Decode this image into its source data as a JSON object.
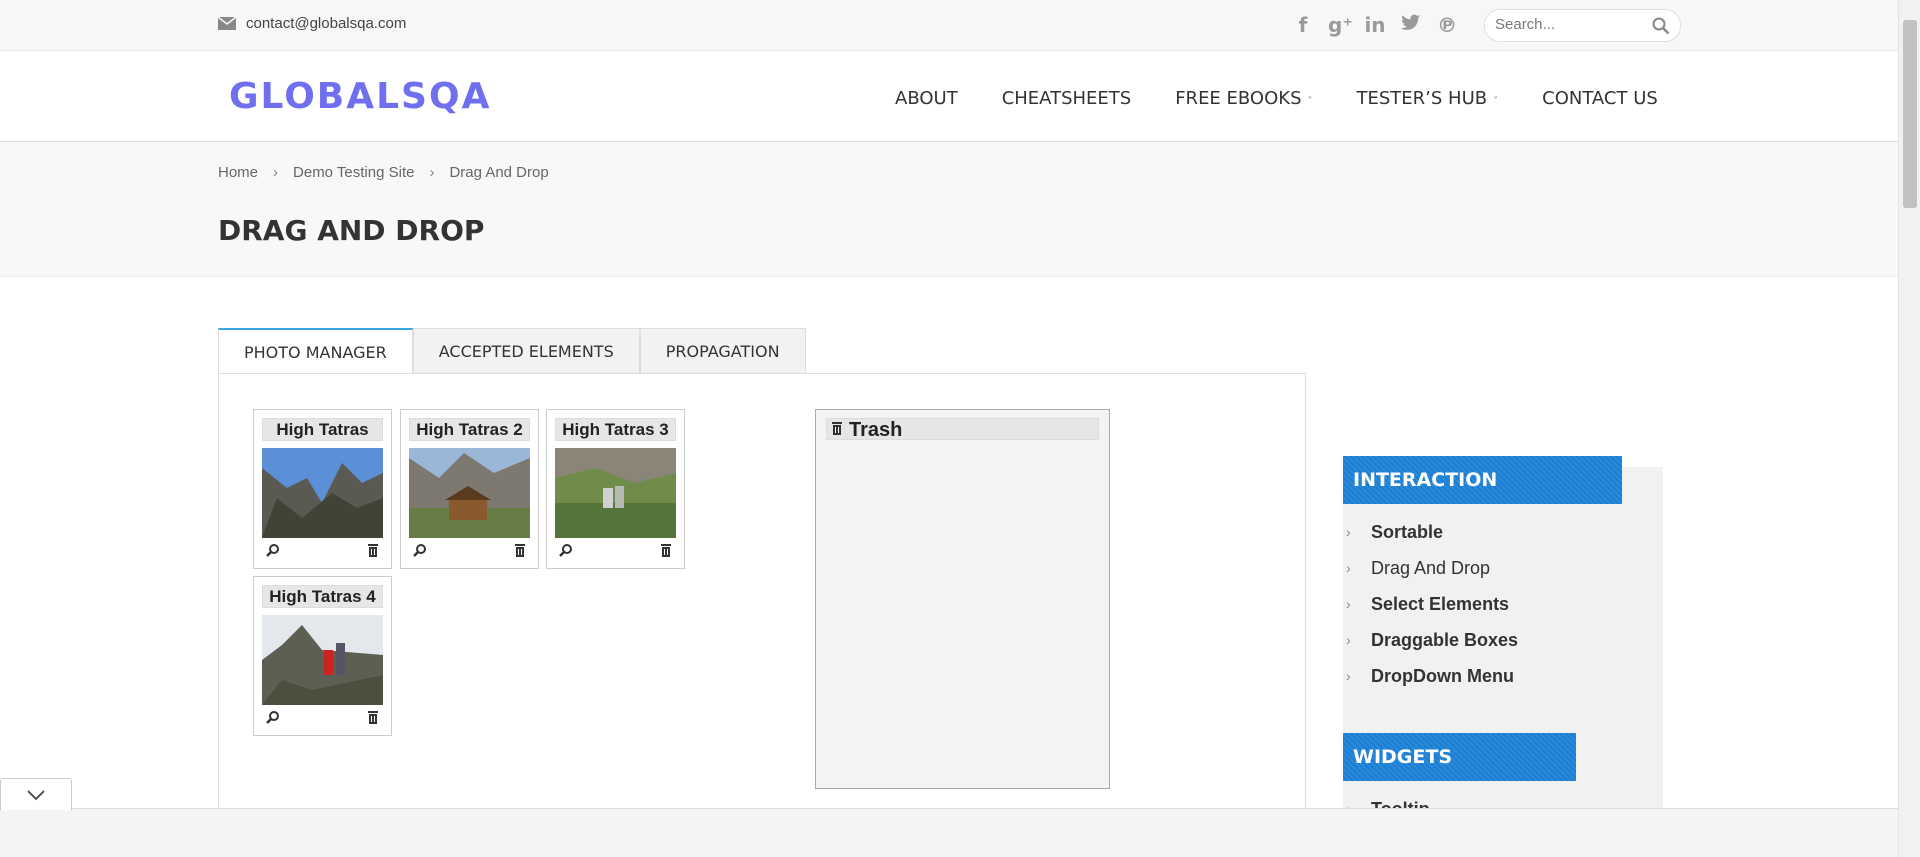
{
  "topbar": {
    "email": "contact@globalsqa.com",
    "social": [
      "facebook-icon",
      "google-plus-icon",
      "linkedin-icon",
      "twitter-icon",
      "pinterest-icon"
    ],
    "search_placeholder": "Search..."
  },
  "header": {
    "logo": "GLOBALSQA",
    "nav": [
      {
        "label": "ABOUT",
        "dropdown": false
      },
      {
        "label": "CHEATSHEETS",
        "dropdown": false
      },
      {
        "label": "FREE EBOOKS",
        "dropdown": true
      },
      {
        "label": "TESTER’S HUB",
        "dropdown": true
      },
      {
        "label": "CONTACT US",
        "dropdown": false
      }
    ]
  },
  "breadcrumb": [
    "Home",
    "Demo Testing Site",
    "Drag And Drop"
  ],
  "page_title": "DRAG AND DROP",
  "tabs": [
    {
      "label": "PHOTO MANAGER",
      "active": true
    },
    {
      "label": "ACCEPTED ELEMENTS",
      "active": false
    },
    {
      "label": "PROPAGATION",
      "active": false
    }
  ],
  "gallery": [
    {
      "title": "High Tatras"
    },
    {
      "title": "High Tatras 2"
    },
    {
      "title": "High Tatras 3"
    },
    {
      "title": "High Tatras 4"
    }
  ],
  "trash": {
    "title": "Trash"
  },
  "sidebar": {
    "interaction": {
      "heading": "INTERACTION",
      "items": [
        "Sortable",
        "Drag And Drop",
        "Select Elements",
        "Draggable Boxes",
        "DropDown Menu"
      ]
    },
    "widgets": {
      "heading": "WIDGETS",
      "items": [
        "Tooltip"
      ]
    }
  },
  "colors": {
    "logo": "#6f6ff0",
    "widget_header": "#1a7fd4",
    "active_tab_border": "#3aa6e0"
  }
}
